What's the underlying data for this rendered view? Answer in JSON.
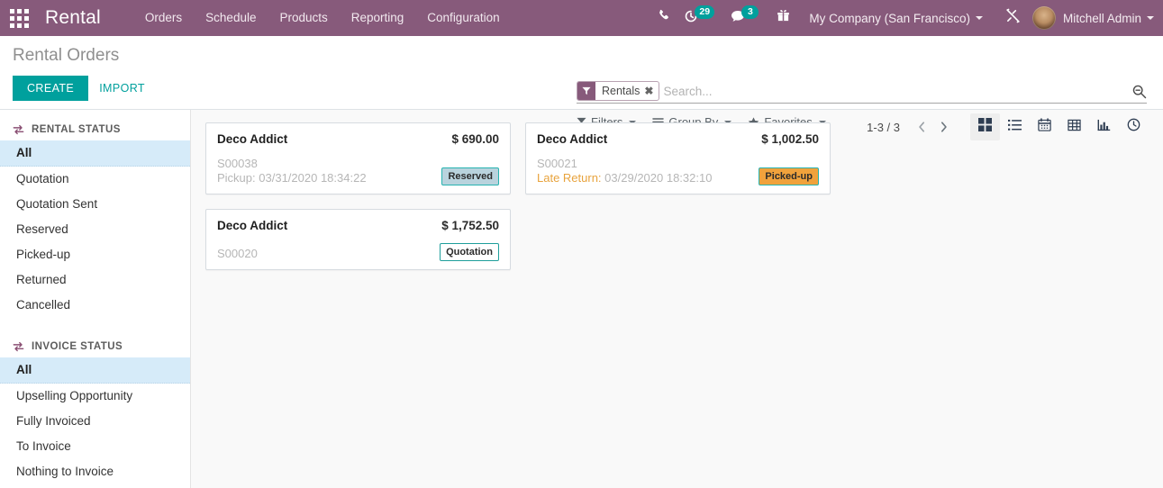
{
  "navbar": {
    "apps_icon": "apps-grid-icon",
    "brand": "Rental",
    "menu": [
      {
        "label": "Orders"
      },
      {
        "label": "Schedule"
      },
      {
        "label": "Products"
      },
      {
        "label": "Reporting"
      },
      {
        "label": "Configuration"
      }
    ],
    "icons": {
      "phone": "phone-icon",
      "activity": "clock-activity-icon",
      "activity_count": "29",
      "messages": "chat-bubble-icon",
      "messages_count": "3",
      "gift": "gift-icon",
      "tools": "tools-icon"
    },
    "company": "My Company (San Francisco)",
    "user": "Mitchell Admin"
  },
  "control_panel": {
    "title": "Rental Orders",
    "create_label": "CREATE",
    "import_label": "IMPORT",
    "search": {
      "facet_label": "Rentals",
      "facet_close": "✖",
      "placeholder": "Search...",
      "toggle_icon": "search-minus-icon"
    },
    "filters": [
      {
        "label": "Filters",
        "icon": "funnel-icon"
      },
      {
        "label": "Group By",
        "icon": "lines-icon"
      },
      {
        "label": "Favorites",
        "icon": "star-icon"
      }
    ],
    "pager": {
      "count": "1-3 / 3",
      "prev": "chevron-left-icon",
      "next": "chevron-right-icon"
    },
    "views": [
      {
        "name": "kanban",
        "icon": "kanban-icon",
        "active": true
      },
      {
        "name": "list",
        "icon": "list-icon",
        "active": false
      },
      {
        "name": "calendar",
        "icon": "calendar-icon",
        "active": false
      },
      {
        "name": "pivot",
        "icon": "pivot-icon",
        "active": false
      },
      {
        "name": "graph",
        "icon": "bar-chart-icon",
        "active": false
      },
      {
        "name": "activity",
        "icon": "clock-icon",
        "active": false
      }
    ]
  },
  "sidebar": {
    "sections": [
      {
        "title": "RENTAL STATUS",
        "icon": "exchange-icon",
        "items": [
          {
            "label": "All",
            "active": true
          },
          {
            "label": "Quotation",
            "active": false
          },
          {
            "label": "Quotation Sent",
            "active": false
          },
          {
            "label": "Reserved",
            "active": false
          },
          {
            "label": "Picked-up",
            "active": false
          },
          {
            "label": "Returned",
            "active": false
          },
          {
            "label": "Cancelled",
            "active": false
          }
        ]
      },
      {
        "title": "INVOICE STATUS",
        "icon": "exchange-icon",
        "items": [
          {
            "label": "All",
            "active": true
          },
          {
            "label": "Upselling Opportunity",
            "active": false
          },
          {
            "label": "Fully Invoiced",
            "active": false
          },
          {
            "label": "To Invoice",
            "active": false
          },
          {
            "label": "Nothing to Invoice",
            "active": false
          }
        ]
      }
    ]
  },
  "kanban": {
    "cards": [
      {
        "customer": "Deco Addict",
        "amount": "$ 690.00",
        "reference": "S00038",
        "date_label": "Pickup:",
        "date_value": "03/31/2020 18:34:22",
        "date_late": false,
        "status": "Reserved",
        "status_style": "reserved"
      },
      {
        "customer": "Deco Addict",
        "amount": "$ 1,002.50",
        "reference": "S00021",
        "date_label": "Late Return:",
        "date_value": "03/29/2020 18:32:10",
        "date_late": true,
        "status": "Picked-up",
        "status_style": "pickedup"
      },
      {
        "customer": "Deco Addict",
        "amount": "$ 1,752.50",
        "reference": "S00020",
        "date_label": "",
        "date_value": "",
        "date_late": false,
        "status": "Quotation",
        "status_style": "quotation"
      }
    ]
  },
  "colors": {
    "brand_purple": "#875A7B",
    "accent_teal": "#00A09D",
    "selected_blue": "#d6ebf9",
    "late_orange": "#e8a33d"
  }
}
